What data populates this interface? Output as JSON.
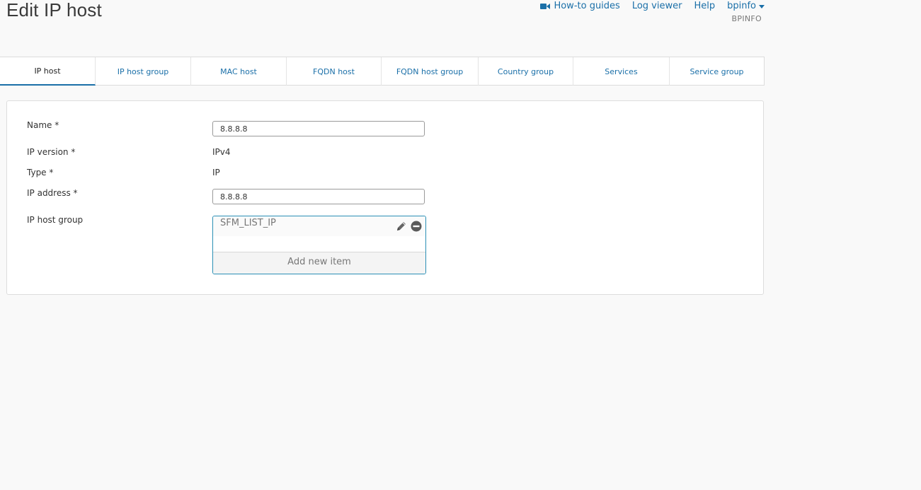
{
  "page": {
    "title": "Edit IP host"
  },
  "topnav": {
    "how_to_guides": "How-to guides",
    "log_viewer": "Log viewer",
    "help": "Help",
    "user": "bpinfo",
    "tenant": "BPINFO"
  },
  "tabs": [
    {
      "label": "IP host",
      "active": true
    },
    {
      "label": "IP host group",
      "active": false
    },
    {
      "label": "MAC host",
      "active": false
    },
    {
      "label": "FQDN host",
      "active": false
    },
    {
      "label": "FQDN host group",
      "active": false
    },
    {
      "label": "Country group",
      "active": false
    },
    {
      "label": "Services",
      "active": false
    },
    {
      "label": "Service group",
      "active": false
    }
  ],
  "form": {
    "name": {
      "label": "Name *",
      "value": "8.8.8.8"
    },
    "ip_version": {
      "label": "IP version *",
      "value": "IPv4"
    },
    "type": {
      "label": "Type *",
      "value": "IP"
    },
    "ip_address": {
      "label": "IP address *",
      "value": "8.8.8.8"
    },
    "ip_host_group": {
      "label": "IP host group",
      "items": [
        "SFM_LIST_IP"
      ],
      "add_label": "Add new item"
    }
  },
  "icons": {
    "video": "video-camera-icon",
    "caret": "chevron-down-icon",
    "edit": "pencil-icon",
    "remove": "minus-circle-icon"
  },
  "colors": {
    "accent": "#1a6fa8",
    "list_border": "#2a8fb5",
    "background": "#f9f9f9"
  }
}
